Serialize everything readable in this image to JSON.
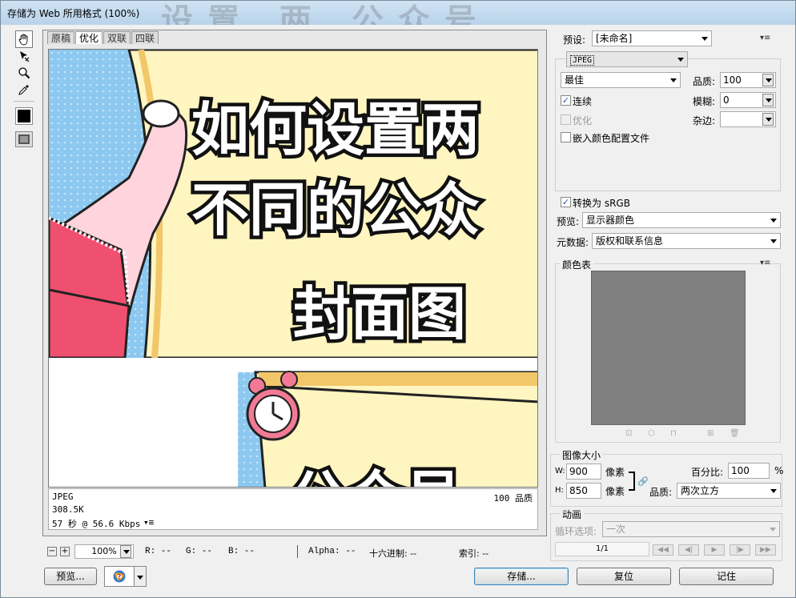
{
  "window": {
    "title": "存储为 Web 所用格式 (100%)",
    "bg_text": "设置 两 公众号"
  },
  "tabs": [
    "原稿",
    "优化",
    "双联",
    "四联"
  ],
  "active_tab": "优化",
  "canvas_art": {
    "line1": "如何设置两",
    "line2": "不同的公众",
    "line3": "封面图",
    "line4": "公众号",
    "colors": {
      "yellow": "#fff5c0",
      "blue": "#8cc8f0",
      "pink": "#ffd4dc",
      "red": "#f05070"
    }
  },
  "image_info": {
    "format": "JPEG",
    "size": "308.5K",
    "time": "57 秒 @ 56.6 Kbps",
    "quality": "100 品质"
  },
  "preset": {
    "label": "预设:",
    "value": "[未命名]"
  },
  "format": {
    "value": "JPEG"
  },
  "quality_select": {
    "value": "最佳"
  },
  "quality": {
    "label": "品质:",
    "value": "100"
  },
  "blur": {
    "label": "模糊:",
    "value": "0"
  },
  "matte": {
    "label": "杂边:",
    "value": ""
  },
  "checks": {
    "progressive": "连续",
    "optimized": "优化",
    "embed_profile": "嵌入颜色配置文件",
    "convert_srgb": "转换为 sRGB"
  },
  "preview": {
    "label": "预览:",
    "value": "显示器颜色"
  },
  "metadata": {
    "label": "元数据:",
    "value": "版权和联系信息"
  },
  "color_table": {
    "label": "颜色表"
  },
  "image_size": {
    "label": "图像大小",
    "w_label": "W:",
    "w_value": "900",
    "h_label": "H:",
    "h_value": "850",
    "unit": "像素",
    "percent_label": "百分比:",
    "percent_value": "100",
    "percent_unit": "%",
    "quality_label": "品质:",
    "quality_value": "两次立方"
  },
  "animation": {
    "label": "动画",
    "loop_label": "循环选项:",
    "loop_value": "一次",
    "frame": "1/1"
  },
  "status_bar": {
    "zoom": "100%",
    "r": "R: --",
    "g": "G: --",
    "b": "B: --",
    "alpha": "Alpha: --",
    "hex": "十六进制: --",
    "index": "索引: --"
  },
  "buttons": {
    "preview": "预览...",
    "save": "存储...",
    "reset": "复位",
    "remember": "记住"
  }
}
